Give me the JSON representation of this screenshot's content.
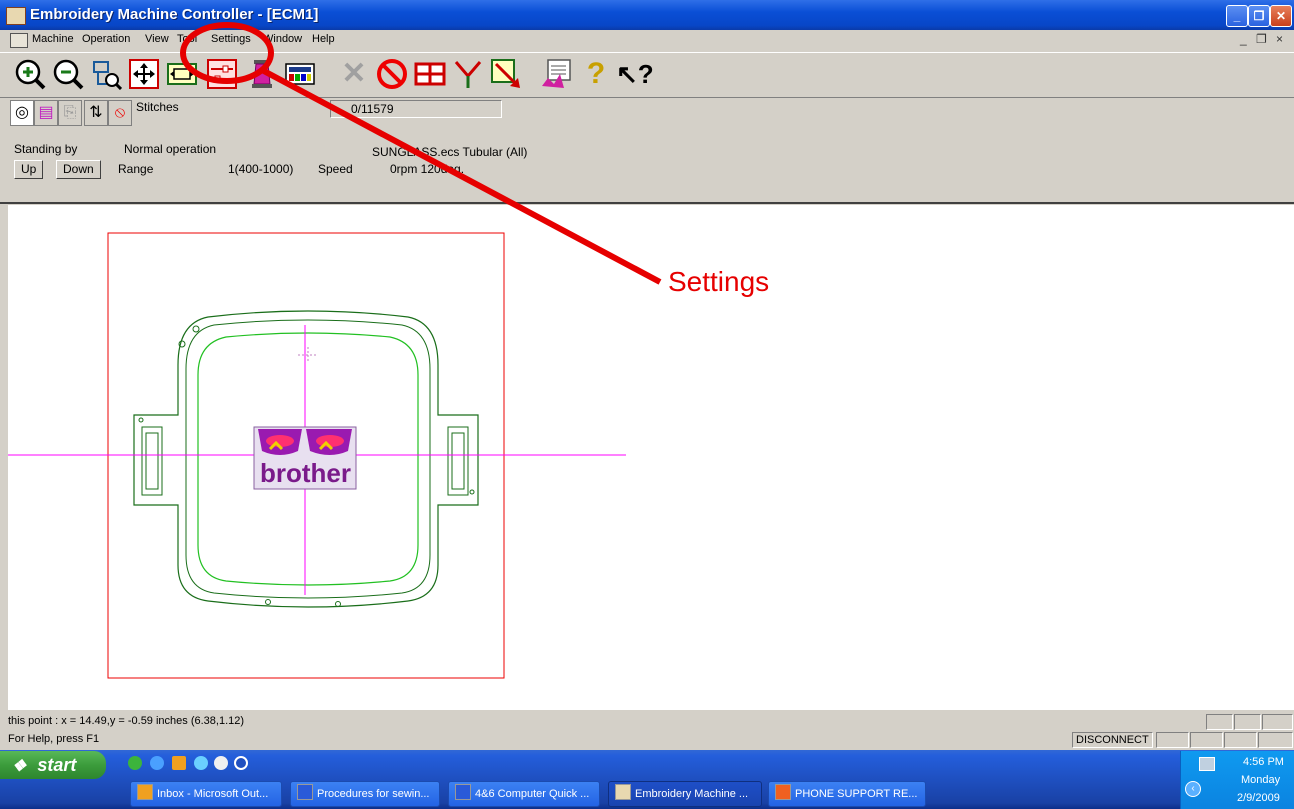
{
  "window": {
    "title": "Embroidery Machine Controller - [ECM1]",
    "controls": [
      "_",
      "❐",
      "✕"
    ]
  },
  "menu": {
    "items": [
      "Machine",
      "Operation",
      "View",
      "Tool",
      "Settings",
      "Window",
      "Help"
    ],
    "mdi_controls": [
      "_",
      "❐",
      "×"
    ]
  },
  "toolbar": {
    "buttons": [
      "zoom-in",
      "zoom-out",
      "zoom-select",
      "fit-design",
      "fit-hoop",
      "settings",
      "thread-spool",
      "color-palette",
      "cancel",
      "stop",
      "frame-grid",
      "branch",
      "arrow-out",
      "design-list",
      "help",
      "context-help"
    ]
  },
  "status_panel": {
    "stitches_label": "Stitches",
    "stitches_value": "0/11579",
    "state": "Standing by",
    "mode": "Normal operation",
    "file": "SUNGLASS.ecs Tubular (All)",
    "up_label": "Up",
    "down_label": "Down",
    "range_label": "Range",
    "range_value": "1(400-1000)",
    "speed_label": "Speed",
    "speed_value": "0rpm 120deg."
  },
  "canvas": {
    "design_text": "brother",
    "annotation": "Settings",
    "accent_red": "#e60000",
    "hoop_color": "#1a6e1a",
    "guide_color": "#ff00ff"
  },
  "statusbar": {
    "coordinates": "this point : x = 14.49,y = -0.59 inches (6.38,1.12)",
    "help": "For Help, press F1",
    "connection": "DISCONNECT"
  },
  "taskbar": {
    "start_label": "start",
    "tasks": [
      "Inbox - Microsoft Out...",
      "Procedures for sewin...",
      "4&6 Computer Quick ...",
      "Embroidery Machine ...",
      "PHONE SUPPORT RE..."
    ],
    "clock_time": "4:56 PM",
    "clock_day": "Monday",
    "clock_date": "2/9/2009"
  }
}
